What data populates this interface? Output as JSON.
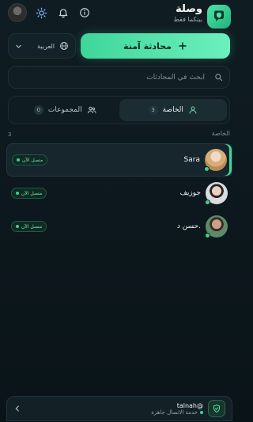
{
  "header": {
    "app_name": "وصلة",
    "app_subtitle": "بينكما فقط"
  },
  "actions": {
    "new_chat_label": "محادثة آمنة",
    "language_label": "العربية"
  },
  "search": {
    "placeholder": "ابحث في المحادثات"
  },
  "tabs": [
    {
      "label": "الخاصة",
      "count": "3",
      "active": true
    },
    {
      "label": "المجموعات",
      "count": "0",
      "active": false
    }
  ],
  "section": {
    "label": "الخاصة",
    "count": "3"
  },
  "chats": [
    {
      "name": "Sara",
      "status": "متصل الآن"
    },
    {
      "name": "جوزيف",
      "status": "متصل الآن"
    },
    {
      "name": "حسن د.",
      "status": "متصل الآن"
    }
  ],
  "footer": {
    "user": "talnah@",
    "status": "خدمة الاتصال جاهزة"
  },
  "colors": {
    "accent": "#3fd69a",
    "background": "#0f1d22",
    "online": "#39d38f"
  }
}
